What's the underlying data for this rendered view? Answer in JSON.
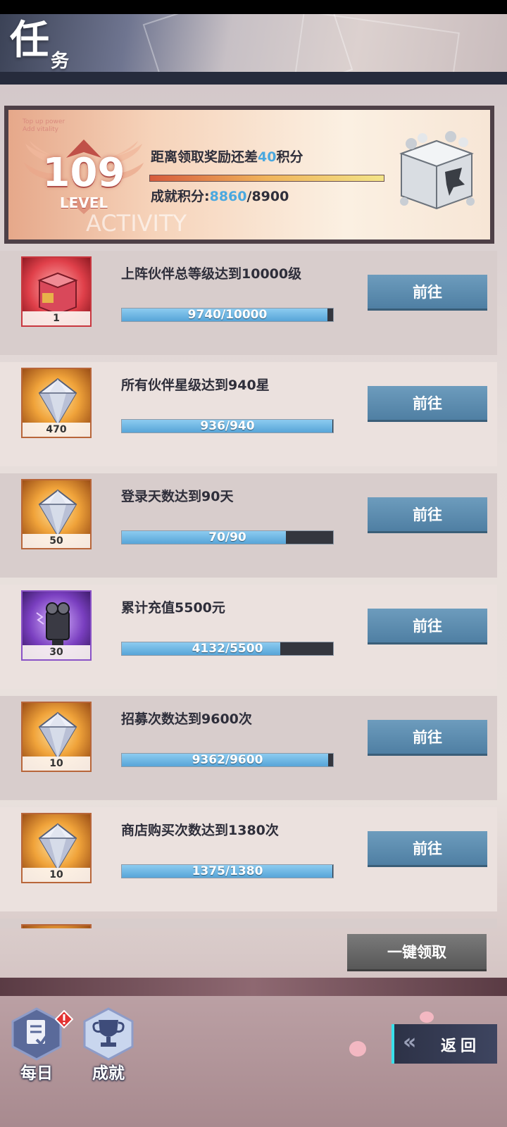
{
  "header": {
    "title_main": "任",
    "title_sub": "务"
  },
  "top_card": {
    "faint_text_1": "Top up power",
    "faint_text_2": "Add vitality",
    "level": "109",
    "level_word": "LEVEL",
    "background_word": "ACTIVITY",
    "distance_prefix": "距离领取奖励还差",
    "distance_value": "40",
    "distance_suffix": "积分",
    "progress_fraction": 1.0,
    "score_label": "成就积分:",
    "score_current": "8860",
    "score_total": "/8900"
  },
  "tasks": [
    {
      "title": "上阵伙伴总等级达到10000级",
      "progress_text": "9740/10000",
      "progress": 0.974,
      "reward_icon": "gift-box-icon",
      "reward_qty": "1",
      "button": "前往"
    },
    {
      "title": "所有伙伴星级达到940星",
      "progress_text": "936/940",
      "progress": 0.996,
      "reward_icon": "diamond-icon",
      "reward_qty": "470",
      "button": "前往"
    },
    {
      "title": "登录天数达到90天",
      "progress_text": "70/90",
      "progress": 0.778,
      "reward_icon": "diamond-icon",
      "reward_qty": "50",
      "button": "前往"
    },
    {
      "title": "累计充值5500元",
      "progress_text": "4132/5500",
      "progress": 0.751,
      "reward_icon": "robot-head-icon",
      "reward_qty": "30",
      "button": "前往"
    },
    {
      "title": "招募次数达到9600次",
      "progress_text": "9362/9600",
      "progress": 0.975,
      "reward_icon": "diamond-icon",
      "reward_qty": "10",
      "button": "前往"
    },
    {
      "title": "商店购买次数达到1380次",
      "progress_text": "1375/1380",
      "progress": 0.996,
      "reward_icon": "diamond-icon",
      "reward_qty": "10",
      "button": "前往"
    }
  ],
  "collect_all_button": "一键领取",
  "bottom_nav": {
    "daily_label": "每日",
    "achievement_label": "成就",
    "back_label": "返回"
  },
  "colors": {
    "highlight_blue": "#4aa8df",
    "button_blue": "#5a89ac",
    "progress_fill": "#6fb8e4",
    "back_accent": "#39e0ea"
  }
}
